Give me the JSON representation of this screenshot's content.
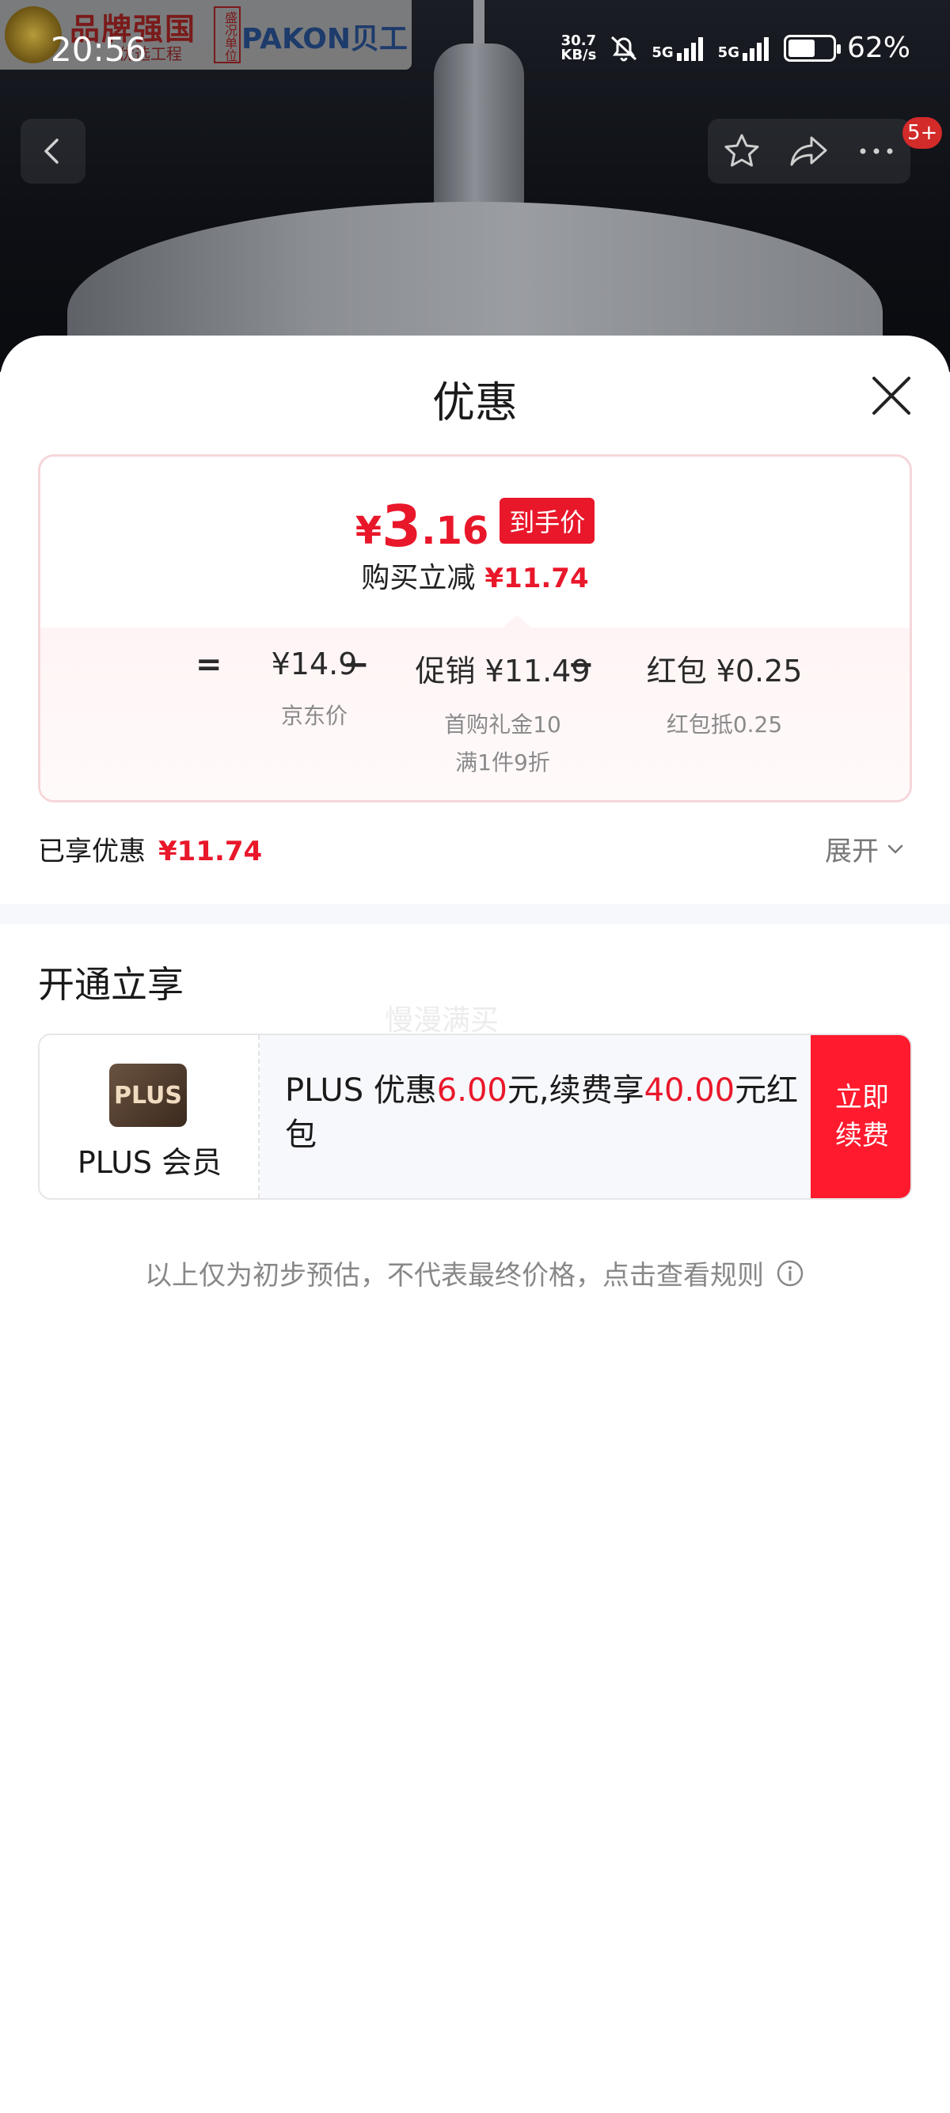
{
  "status_bar": {
    "time": "20:56",
    "net_speed_value": "30.7",
    "net_speed_unit": "KB/s",
    "signal_1": "5G",
    "signal_2": "5G",
    "battery_percent": 62,
    "battery_label": "62%"
  },
  "brand_banner": {
    "name_cn": "品牌强国",
    "subtitle": "优选工程",
    "tag": "盛况单位",
    "brand_en": "PAKON贝工"
  },
  "nav": {
    "badge": "5+"
  },
  "sheet": {
    "title": "优惠",
    "final_price": {
      "currency": "¥",
      "integer": "3",
      "decimal": ".16",
      "tag": "到手价"
    },
    "reduce": {
      "label": "购买立减",
      "amount": "¥11.74"
    },
    "calc": {
      "equals": "=",
      "minus": "−",
      "items": [
        {
          "main": "¥14.9",
          "sub": [
            "京东价"
          ]
        },
        {
          "main": "促销 ¥11.49",
          "sub": [
            "首购礼金10",
            "满1件9折"
          ]
        },
        {
          "main": "红包 ¥0.25",
          "sub": [
            "红包抵0.25"
          ]
        }
      ]
    },
    "enjoyed": {
      "label": "已享优惠",
      "amount": "¥11.74"
    },
    "expand_label": "展开",
    "open_section_title": "开通立享",
    "watermark": "慢漫满买",
    "plus": {
      "logo_text": "PLUS",
      "name": "PLUS 会员",
      "desc_prefix": "PLUS 优惠",
      "desc_amount1": "6.00",
      "desc_mid": "元,续费享",
      "desc_amount2": "40.00",
      "desc_suffix": "元红包",
      "renew_button": "立即续费"
    },
    "disclaimer": "以上仅为初步预估，不代表最终价格，点击查看规则"
  },
  "colors": {
    "accent_red": "#e9172a",
    "renew_red": "#ff1a2e",
    "card_border": "#f6d6da"
  },
  "icons": {
    "back": "chevron-left-icon",
    "favorite": "star-icon",
    "share": "share-icon",
    "more": "more-icon",
    "close": "close-icon",
    "expand": "chevron-down-icon",
    "info": "info-icon"
  }
}
